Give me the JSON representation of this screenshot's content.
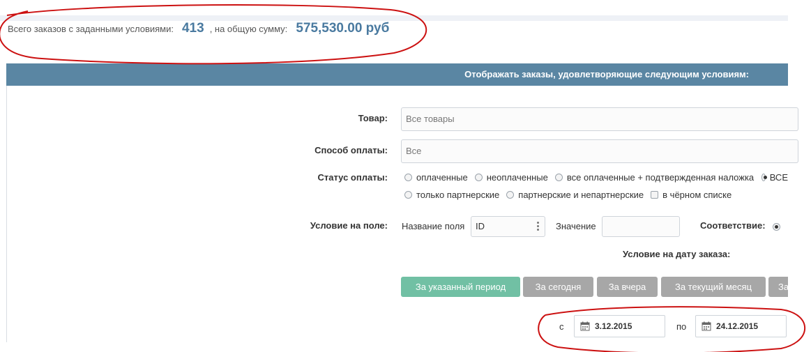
{
  "summary": {
    "orders_label": "Всего заказов с заданными условиями:",
    "orders_count": "413",
    "sum_label": ", на общую сумму:",
    "sum_value": "575,530.00 руб"
  },
  "panel": {
    "title": "Отображать заказы, удовлетворяющие следующим условиям:"
  },
  "product": {
    "label": "Товар:",
    "value": "Все товары"
  },
  "payment_method": {
    "label": "Способ оплаты:",
    "value": "Все"
  },
  "payment_status": {
    "label": "Статус оплаты:",
    "options": [
      {
        "label": "оплаченные",
        "checked": false
      },
      {
        "label": "неоплаченные",
        "checked": false
      },
      {
        "label": "все оплаченные + подтвержденная наложка",
        "checked": false
      },
      {
        "label": "ВСЕ",
        "checked": true
      },
      {
        "label": "только партнерские",
        "checked": false
      },
      {
        "label": "партнерские и непартнерские",
        "checked": false
      }
    ],
    "blacklist_label": "в чёрном списке",
    "blacklist_checked": false
  },
  "field_condition": {
    "label": "Условие на поле:",
    "field_name_label": "Название поля",
    "field_name_value": "ID",
    "value_label": "Значение",
    "value_value": "",
    "match_label": "Соответствие:"
  },
  "date_condition": {
    "label": "Условие на дату заказа:",
    "buttons": [
      {
        "label": "За указанный период",
        "active": true
      },
      {
        "label": "За сегодня",
        "active": false
      },
      {
        "label": "За вчера",
        "active": false
      },
      {
        "label": "За текущий месяц",
        "active": false
      },
      {
        "label": "За",
        "active": false
      }
    ],
    "from_label": "с",
    "from_value": "3.12.2015",
    "to_label": "по",
    "to_value": "24.12.2015"
  },
  "colors": {
    "header": "#5a86a3",
    "accent_text": "#4a7aa0",
    "active_button": "#71c0a4",
    "inactive_button": "#a7a7a7",
    "annotation": "#cc1111"
  }
}
